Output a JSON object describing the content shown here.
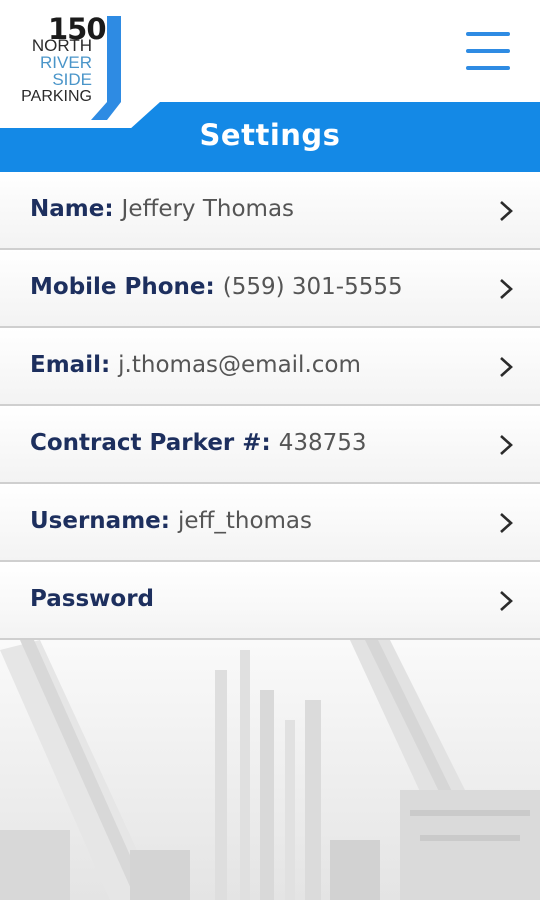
{
  "logo": {
    "number": "150",
    "line1": "NORTH",
    "line2": "RIVER",
    "line3": "SIDE",
    "line4": "PARKING"
  },
  "header": {
    "title": "Settings",
    "menu_icon": "hamburger-menu-icon",
    "accent_color": "#1489e6"
  },
  "settings": {
    "rows": [
      {
        "label": "Name:",
        "value": "Jeffery Thomas"
      },
      {
        "label": "Mobile Phone:",
        "value": "(559) 301-5555"
      },
      {
        "label": "Email:",
        "value": "j.thomas@email.com"
      },
      {
        "label": "Contract Parker #:",
        "value": "438753"
      },
      {
        "label": "Username:",
        "value": "jeff_thomas"
      },
      {
        "label": "Password",
        "value": ""
      }
    ],
    "chevron_icon": "chevron-right-icon"
  }
}
